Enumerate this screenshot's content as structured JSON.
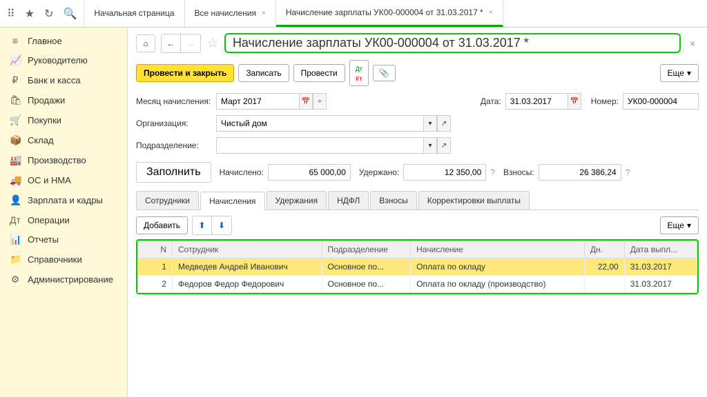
{
  "topTabs": [
    {
      "label": "Начальная страница",
      "closable": false
    },
    {
      "label": "Все начисления",
      "closable": true
    },
    {
      "label": "Начисление зарплаты УК00-000004\nот 31.03.2017 *",
      "closable": true,
      "active": true
    }
  ],
  "sidebar": [
    {
      "icon": "≡",
      "label": "Главное"
    },
    {
      "icon": "📈",
      "label": "Руководителю"
    },
    {
      "icon": "₽",
      "label": "Банк и касса"
    },
    {
      "icon": "🛍",
      "label": "Продажи"
    },
    {
      "icon": "🛒",
      "label": "Покупки"
    },
    {
      "icon": "📦",
      "label": "Склад"
    },
    {
      "icon": "🏭",
      "label": "Производство"
    },
    {
      "icon": "🚚",
      "label": "ОС и НМА"
    },
    {
      "icon": "👤",
      "label": "Зарплата и кадры"
    },
    {
      "icon": "Дт",
      "label": "Операции"
    },
    {
      "icon": "📊",
      "label": "Отчеты"
    },
    {
      "icon": "📁",
      "label": "Справочники"
    },
    {
      "icon": "⚙",
      "label": "Администрирование"
    }
  ],
  "doc": {
    "title": "Начисление зарплаты УК00-000004 от 31.03.2017 *",
    "buttons": {
      "postClose": "Провести и закрыть",
      "save": "Записать",
      "post": "Провести",
      "more": "Еще"
    },
    "labels": {
      "month": "Месяц начисления:",
      "date": "Дата:",
      "number": "Номер:",
      "org": "Организация:",
      "dept": "Подразделение:",
      "fill": "Заполнить",
      "accrued": "Начислено:",
      "withheld": "Удержано:",
      "contrib": "Взносы:",
      "add": "Добавить"
    },
    "values": {
      "month": "Март 2017",
      "date": "31.03.2017",
      "number": "УК00-000004",
      "org": "Чистый дом",
      "dept": "",
      "accrued": "65 000,00",
      "withheld": "12 350,00",
      "contrib": "26 386,24"
    },
    "tabs": [
      "Сотрудники",
      "Начисления",
      "Удержания",
      "НДФЛ",
      "Взносы",
      "Корректировки выплаты"
    ],
    "activeTab": 1,
    "columns": [
      "N",
      "Сотрудник",
      "Подразделение",
      "Начисление",
      "Дн.",
      "Дата выпл..."
    ],
    "rows": [
      {
        "n": "1",
        "emp": "Медведев Андрей Иванович",
        "dept": "Основное по...",
        "accr": "Оплата по окладу",
        "days": "22,00",
        "date": "31.03.2017",
        "selected": true
      },
      {
        "n": "2",
        "emp": "Федоров Федор Федорович",
        "dept": "Основное по...",
        "accr": "Оплата по окладу (производство)",
        "days": "",
        "date": "31.03.2017",
        "selected": false
      }
    ]
  }
}
